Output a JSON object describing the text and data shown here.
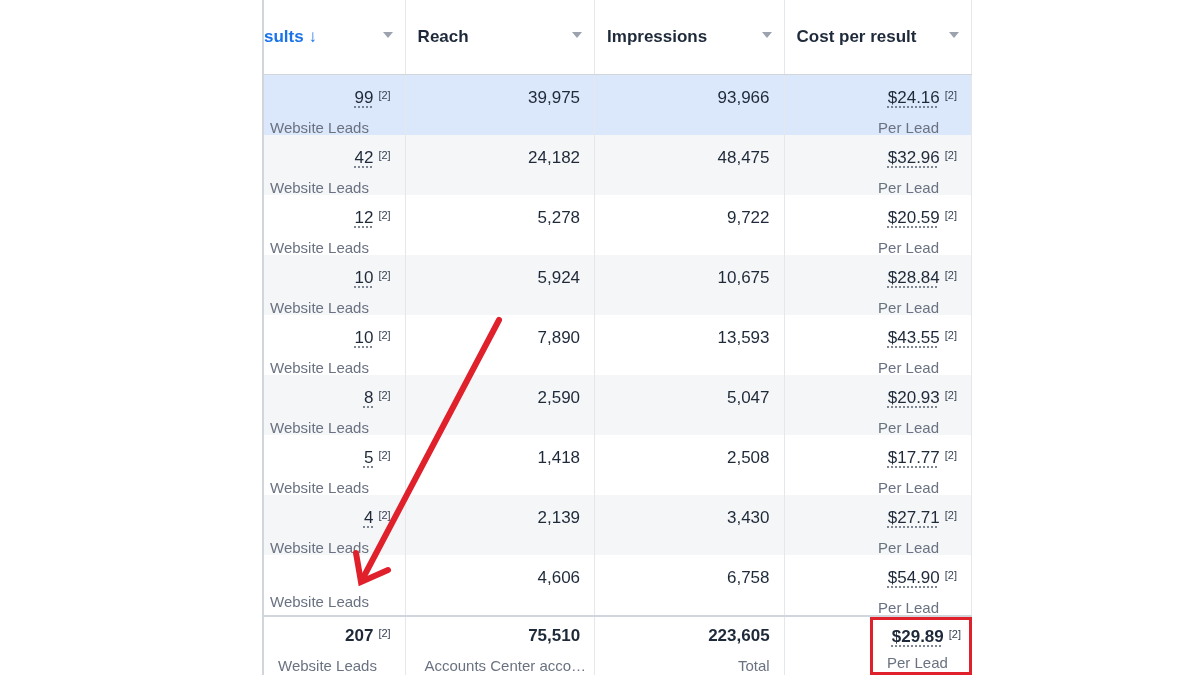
{
  "table": {
    "columns": [
      {
        "label": "sults ↓",
        "sorted": true
      },
      {
        "label": "Reach",
        "sorted": false
      },
      {
        "label": "Impressions",
        "sorted": false
      },
      {
        "label": "Cost per result",
        "sorted": false
      }
    ],
    "rows": [
      {
        "selected": true,
        "results": "99",
        "results_note": "[2]",
        "results_type": "Website Leads",
        "reach": "39,975",
        "impressions": "93,966",
        "cost": "$24.16",
        "cost_note": "[2]",
        "cost_unit": "Per Lead"
      },
      {
        "selected": false,
        "results": "42",
        "results_note": "[2]",
        "results_type": "Website Leads",
        "reach": "24,182",
        "impressions": "48,475",
        "cost": "$32.96",
        "cost_note": "[2]",
        "cost_unit": "Per Lead"
      },
      {
        "selected": false,
        "results": "12",
        "results_note": "[2]",
        "results_type": "Website Leads",
        "reach": "5,278",
        "impressions": "9,722",
        "cost": "$20.59",
        "cost_note": "[2]",
        "cost_unit": "Per Lead"
      },
      {
        "selected": false,
        "results": "10",
        "results_note": "[2]",
        "results_type": "Website Leads",
        "reach": "5,924",
        "impressions": "10,675",
        "cost": "$28.84",
        "cost_note": "[2]",
        "cost_unit": "Per Lead"
      },
      {
        "selected": false,
        "results": "10",
        "results_note": "[2]",
        "results_type": "Website Leads",
        "reach": "7,890",
        "impressions": "13,593",
        "cost": "$43.55",
        "cost_note": "[2]",
        "cost_unit": "Per Lead"
      },
      {
        "selected": false,
        "results": "8",
        "results_note": "[2]",
        "results_type": "Website Leads",
        "reach": "2,590",
        "impressions": "5,047",
        "cost": "$20.93",
        "cost_note": "[2]",
        "cost_unit": "Per Lead"
      },
      {
        "selected": false,
        "results": "5",
        "results_note": "[2]",
        "results_type": "Website Leads",
        "reach": "1,418",
        "impressions": "2,508",
        "cost": "$17.77",
        "cost_note": "[2]",
        "cost_unit": "Per Lead"
      },
      {
        "selected": false,
        "results": "4",
        "results_note": "[2]",
        "results_type": "Website Leads",
        "reach": "2,139",
        "impressions": "3,430",
        "cost": "$27.71",
        "cost_note": "[2]",
        "cost_unit": "Per Lead"
      },
      {
        "selected": false,
        "results_type": "Website Leads",
        "reach": "4,606",
        "impressions": "6,758",
        "cost": "$54.90",
        "cost_note": "[2]",
        "cost_unit": "Per Lead"
      }
    ],
    "totals": {
      "results": "207",
      "results_note": "[2]",
      "results_type": "Website Leads",
      "reach": "75,510",
      "reach_label": "Accounts Center acco…",
      "impressions": "223,605",
      "impressions_label": "Total",
      "cost": "$29.89",
      "cost_note": "[2]",
      "cost_unit": "Per Lead",
      "highlighted": true
    }
  },
  "annotation": {
    "arrow": true
  }
}
